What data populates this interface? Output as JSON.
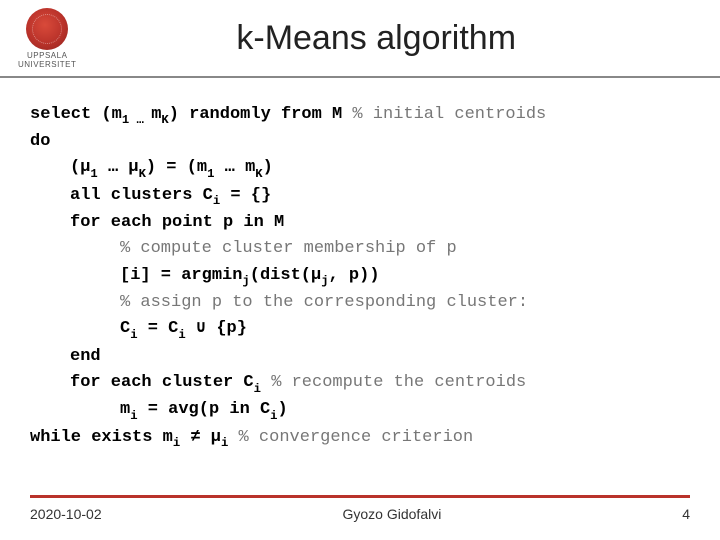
{
  "logo": {
    "line1": "UPPSALA",
    "line2": "UNIVERSITET"
  },
  "title": "k-Means algorithm",
  "code": {
    "l1a": "select (m",
    "l1b": " m",
    "l1c": ") randomly from M ",
    "l1d": "% initial centroids",
    "l2": "do",
    "l3a": "(µ",
    "l3b": " … µ",
    "l3c": ") = (m",
    "l3d": " … m",
    "l3e": ")",
    "l4a": "all clusters C",
    "l4b": " = {}",
    "l5": "for each point p in M",
    "l6": "% compute cluster membership of p",
    "l7a": "[i] = argmin",
    "l7b": "(dist(µ",
    "l7c": ", p))",
    "l8": "% assign p to the corresponding cluster:",
    "l9a": "C",
    "l9b": " = C",
    "l9c": " ∪ {p}",
    "l10": "end",
    "l11a": "for each cluster C",
    "l11b": " ",
    "l11c": "% recompute the centroids",
    "l12a": "m",
    "l12b": " = avg(p in C",
    "l12c": ")",
    "l13a": "while exists m",
    "l13b": " ≠ µ",
    "l13c": " ",
    "l13d": "% convergence criterion",
    "sub1": "1",
    "subK": "K",
    "subi": "i",
    "subj": "j",
    "ellips": " … "
  },
  "footer": {
    "date": "2020-10-02",
    "author": "Gyozo Gidofalvi",
    "page": "4"
  }
}
